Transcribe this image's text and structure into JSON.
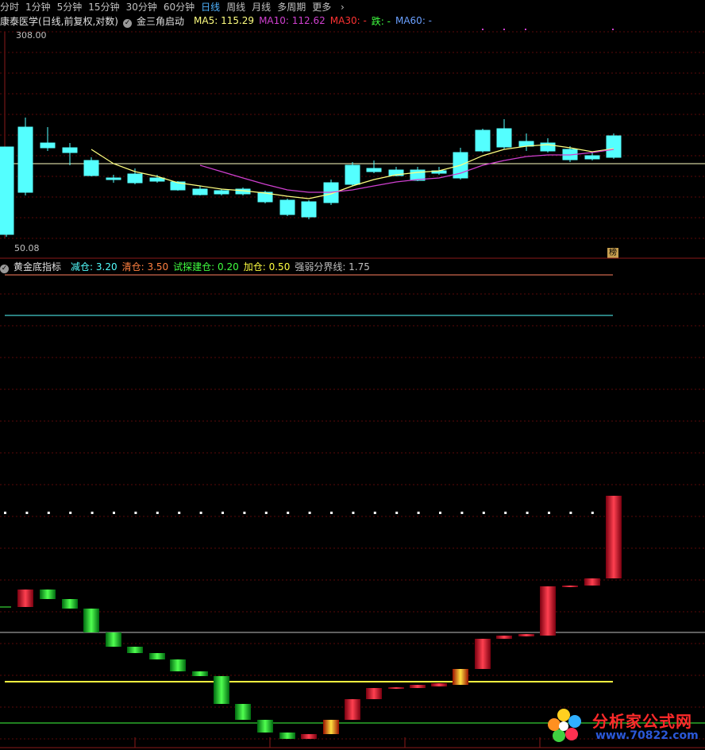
{
  "periods": {
    "items": [
      "分时",
      "1分钟",
      "5分钟",
      "15分钟",
      "30分钟",
      "60分钟",
      "日线",
      "周线",
      "月线",
      "多周期",
      "更多"
    ],
    "active": "日线"
  },
  "main_chart": {
    "title": "康泰医学(日线,前复权,对数)",
    "indicator": "金三角启动",
    "ma5_label": "MA5: 115.29",
    "ma10_label": "MA10: 112.62",
    "ma30_label": "MA30: -",
    "die_label": "跌: -",
    "ma60_label": "MA60: -",
    "max_price": "308.00",
    "min_price": "50.08",
    "badge": "榜",
    "colors": {
      "up": "#ff3232",
      "down": "#54ffff",
      "ma5": "#ffff80",
      "ma10": "#d040d0",
      "ma30": "#ff3232",
      "ma60": "#6aa0ff"
    }
  },
  "sub_chart": {
    "title": "黄金底指标",
    "items": [
      {
        "label": "减仓: 3.20",
        "color": "#54ffff"
      },
      {
        "label": "清仓: 3.50",
        "color": "#ff8040"
      },
      {
        "label": "试探建仓: 0.20",
        "color": "#40ff40"
      },
      {
        "label": "加仓: 0.50",
        "color": "#ffff40"
      },
      {
        "label": "强弱分界线: 1.75",
        "color": "#c0c0c0"
      }
    ]
  },
  "watermark": {
    "title": "分析家公式网",
    "url": "www.70822.com"
  }
}
